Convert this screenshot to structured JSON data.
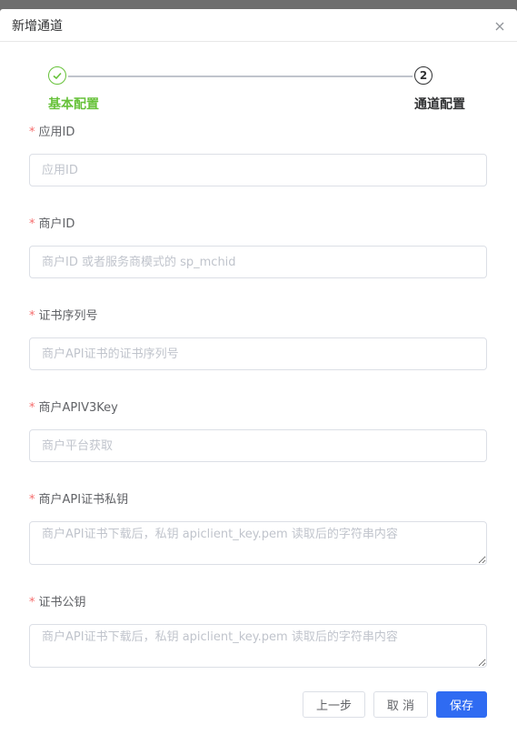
{
  "dialog": {
    "title": "新增通道"
  },
  "steps": [
    {
      "label": "基本配置",
      "status": "finish"
    },
    {
      "label": "通道配置",
      "number": "2",
      "status": "process"
    }
  ],
  "fields": [
    {
      "label": "应用ID",
      "placeholder": "应用ID",
      "value": ""
    },
    {
      "label": "商户ID",
      "placeholder": "商户ID 或者服务商模式的 sp_mchid",
      "value": ""
    },
    {
      "label": "证书序列号",
      "placeholder": "商户API证书的证书序列号",
      "value": ""
    },
    {
      "label": "商户APIV3Key",
      "placeholder": "商户平台获取",
      "value": ""
    },
    {
      "label": "商户API证书私钥",
      "placeholder": "商户API证书下载后，私钥 apiclient_key.pem 读取后的字符串内容",
      "value": ""
    },
    {
      "label": "证书公钥",
      "placeholder": "商户API证书下载后，私钥 apiclient_key.pem 读取后的字符串内容",
      "value": ""
    }
  ],
  "required_mark": "*",
  "buttons": {
    "prev": "上一步",
    "cancel": "取 消",
    "save": "保存"
  },
  "colors": {
    "primary": "#2f6bf2",
    "success": "#67c23a",
    "required": "#f56c6c"
  }
}
